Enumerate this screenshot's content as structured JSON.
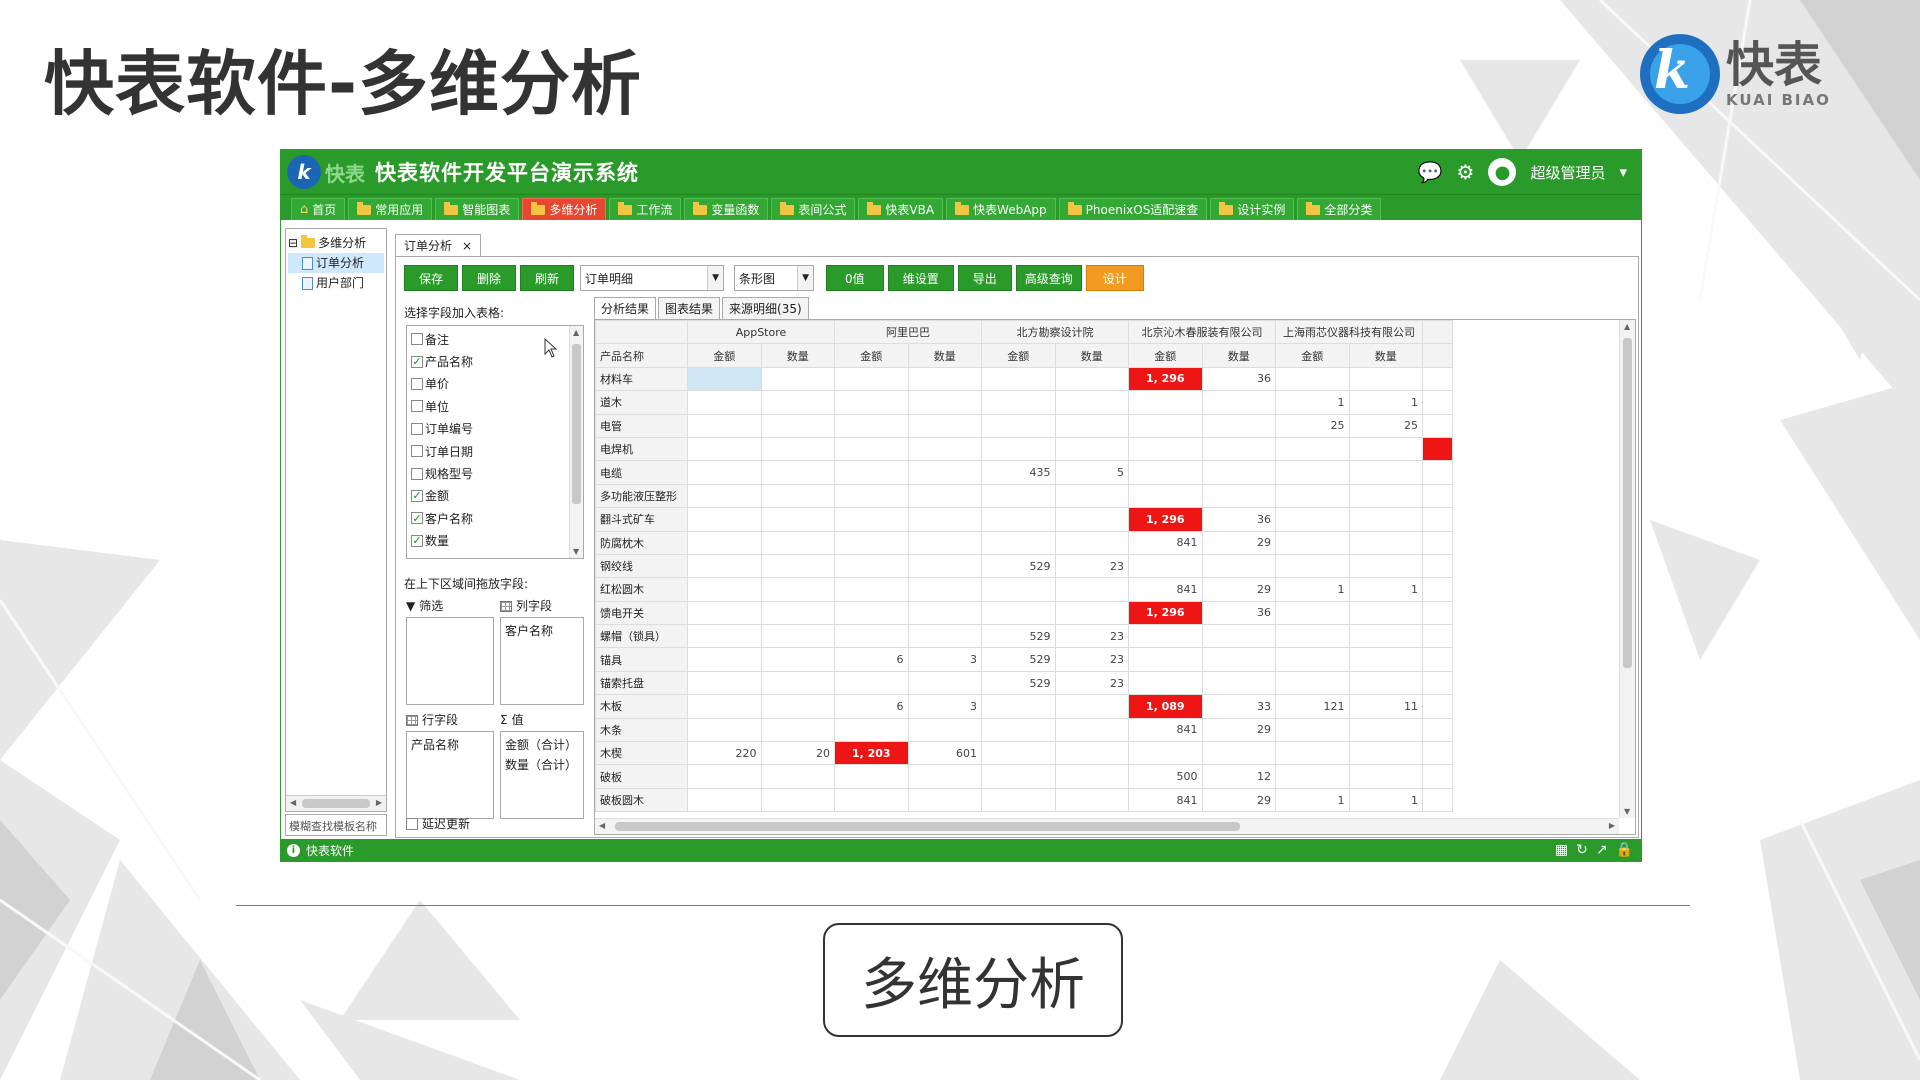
{
  "slide": {
    "title": "快表软件-多维分析",
    "logo_cn": "快表",
    "logo_en": "KUAI BIAO",
    "caption": "多维分析"
  },
  "app": {
    "logo_cn": "快表",
    "title": "快表软件开发平台演示系统",
    "user": "超级管理员",
    "status_text": "快表软件"
  },
  "menu": [
    "首页",
    "常用应用",
    "智能图表",
    "多维分析",
    "工作流",
    "变量函数",
    "表间公式",
    "快表VBA",
    "快表WebApp",
    "PhoenixOS适配速查",
    "设计实例",
    "全部分类"
  ],
  "tree": {
    "root": "多维分析",
    "children": [
      "订单分析",
      "用户部门"
    ],
    "search": "模糊查找模板名称"
  },
  "doc_tab": "订单分析",
  "toolbar": {
    "save": "保存",
    "delete": "删除",
    "refresh": "刷新",
    "source": "订单明细",
    "chart_type": "条形图",
    "zero": "0值",
    "dim_settings": "维设置",
    "export": "导出",
    "advanced_query": "高级查询",
    "design": "设计"
  },
  "field_panel": {
    "label": "选择字段加入表格:",
    "fields": [
      {
        "name": "备注",
        "checked": false
      },
      {
        "name": "产品名称",
        "checked": true
      },
      {
        "name": "单价",
        "checked": false
      },
      {
        "name": "单位",
        "checked": false
      },
      {
        "name": "订单编号",
        "checked": false
      },
      {
        "name": "订单日期",
        "checked": false
      },
      {
        "name": "规格型号",
        "checked": false
      },
      {
        "name": "金额",
        "checked": true
      },
      {
        "name": "客户名称",
        "checked": true
      },
      {
        "name": "数量",
        "checked": true
      }
    ],
    "drag_label": "在上下区域间拖放字段:",
    "filter": "筛选",
    "column_fields": "列字段",
    "column_items": [
      "客户名称"
    ],
    "row_fields": "行字段",
    "values": "值",
    "row_items": [
      "产品名称"
    ],
    "value_items": [
      "金额（合计）",
      "数量（合计）"
    ],
    "delay_update": "延迟更新"
  },
  "result_tabs": [
    "分析结果",
    "图表结果",
    "来源明细(35)"
  ],
  "grid": {
    "corner": "产品名称",
    "customers": [
      "AppStore",
      "阿里巴巴",
      "北方勘察设计院",
      "北京沁木春服装有限公司",
      "上海雨芯仪器科技有限公司"
    ],
    "measures": [
      "金额",
      "数量"
    ],
    "rows": [
      {
        "name": "材料车",
        "cells": [
          "",
          "",
          "",
          "",
          "",
          "",
          "1, 296",
          "36",
          "",
          ""
        ]
      },
      {
        "name": "道木",
        "cells": [
          "",
          "",
          "",
          "",
          "",
          "",
          "",
          "",
          "1",
          "1"
        ]
      },
      {
        "name": "电管",
        "cells": [
          "",
          "",
          "",
          "",
          "",
          "",
          "",
          "",
          "25",
          "25"
        ]
      },
      {
        "name": "电焊机",
        "cells": [
          "",
          "",
          "",
          "",
          "",
          "",
          "",
          "",
          "",
          ""
        ]
      },
      {
        "name": "电缆",
        "cells": [
          "",
          "",
          "",
          "",
          "435",
          "5",
          "",
          "",
          "",
          ""
        ]
      },
      {
        "name": "多功能液压整形",
        "cells": [
          "",
          "",
          "",
          "",
          "",
          "",
          "",
          "",
          "",
          ""
        ]
      },
      {
        "name": "翻斗式矿车",
        "cells": [
          "",
          "",
          "",
          "",
          "",
          "",
          "1, 296",
          "36",
          "",
          ""
        ]
      },
      {
        "name": "防腐枕木",
        "cells": [
          "",
          "",
          "",
          "",
          "",
          "",
          "841",
          "29",
          "",
          ""
        ]
      },
      {
        "name": "钢绞线",
        "cells": [
          "",
          "",
          "",
          "",
          "529",
          "23",
          "",
          "",
          "",
          ""
        ]
      },
      {
        "name": "红松圆木",
        "cells": [
          "",
          "",
          "",
          "",
          "",
          "",
          "841",
          "29",
          "1",
          "1"
        ]
      },
      {
        "name": "馈电开关",
        "cells": [
          "",
          "",
          "",
          "",
          "",
          "",
          "1, 296",
          "36",
          "",
          ""
        ]
      },
      {
        "name": "螺帽（锁具）",
        "cells": [
          "",
          "",
          "",
          "",
          "529",
          "23",
          "",
          "",
          "",
          ""
        ]
      },
      {
        "name": "锚具",
        "cells": [
          "",
          "",
          "6",
          "3",
          "529",
          "23",
          "",
          "",
          "",
          ""
        ]
      },
      {
        "name": "锚索托盘",
        "cells": [
          "",
          "",
          "",
          "",
          "529",
          "23",
          "",
          "",
          "",
          ""
        ]
      },
      {
        "name": "木板",
        "cells": [
          "",
          "",
          "6",
          "3",
          "",
          "",
          "1, 089",
          "33",
          "121",
          "11"
        ]
      },
      {
        "name": "木条",
        "cells": [
          "",
          "",
          "",
          "",
          "",
          "",
          "841",
          "29",
          "",
          ""
        ]
      },
      {
        "name": "木楔",
        "cells": [
          "220",
          "20",
          "1, 203",
          "601",
          "",
          "",
          "",
          "",
          "",
          ""
        ]
      },
      {
        "name": "破板",
        "cells": [
          "",
          "",
          "",
          "",
          "",
          "",
          "500",
          "12",
          "",
          ""
        ]
      },
      {
        "name": "破板圆木",
        "cells": [
          "",
          "",
          "",
          "",
          "",
          "",
          "841",
          "29",
          "1",
          "1"
        ]
      }
    ],
    "highlight_color": "#ee1515",
    "accent_color": "#2a9b2a"
  }
}
